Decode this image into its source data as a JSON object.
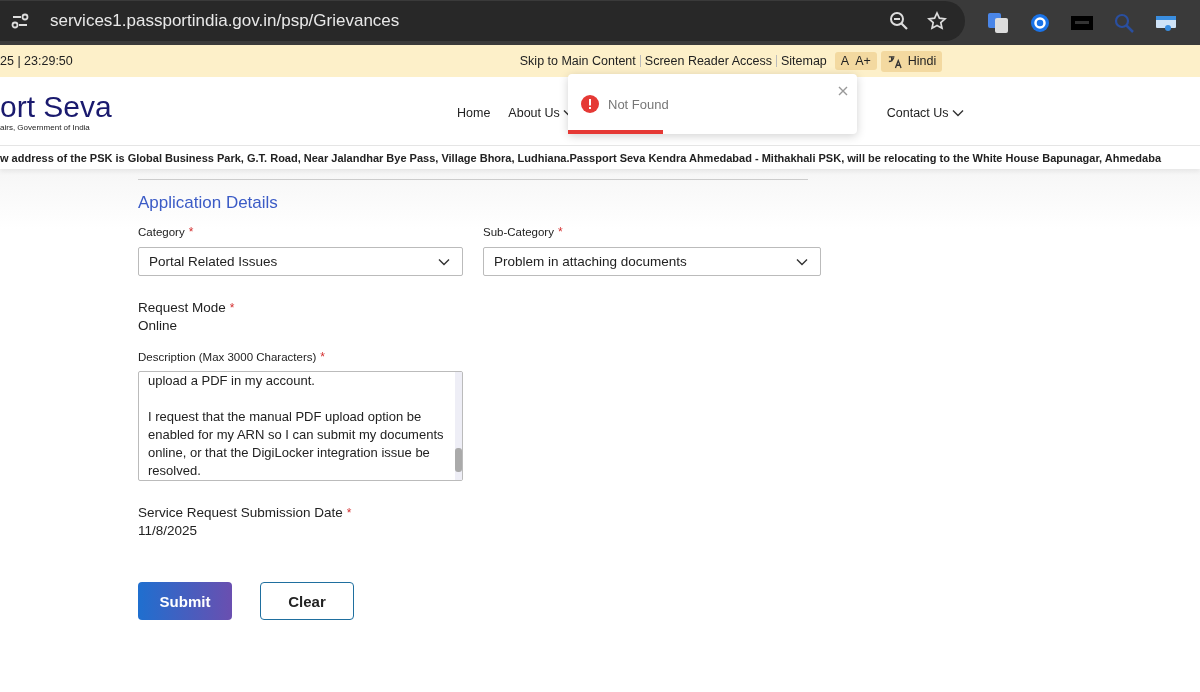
{
  "browser": {
    "url": "services1.passportindia.gov.in/psp/Grievances"
  },
  "top_bar": {
    "datetime": "25 | 23:29:50",
    "links": [
      "Skip to Main Content",
      "Screen Reader Access",
      "Sitemap"
    ],
    "font_sizes": [
      "A",
      "A+"
    ],
    "language": "Hindi"
  },
  "header": {
    "logo_title": "ort Seva",
    "logo_subtitle": "airs, Government of India",
    "nav": [
      {
        "label": "Home",
        "dropdown": false
      },
      {
        "label": "About Us",
        "dropdown": true
      },
      {
        "label": "Contact Us",
        "dropdown": true
      }
    ]
  },
  "ticker": "w address of the PSK is Global Business Park, G.T. Road, Near Jalandhar Bye Pass, Village Bhora, Ludhiana.Passport Seva Kendra Ahmedabad - Mithakhali PSK, will be relocating to the White House Bapunagar, Ahmedaba",
  "toast": {
    "message": "Not Found",
    "level": 0.33
  },
  "form": {
    "section_title": "Application Details",
    "category": {
      "label": "Category",
      "required_mark": "*",
      "value": "Portal Related Issues"
    },
    "sub_category": {
      "label": "Sub-Category",
      "required_mark": "*",
      "value": "Problem in attaching documents"
    },
    "request_mode": {
      "label": "Request Mode",
      "required_mark": "*",
      "value": "Online"
    },
    "description": {
      "label": "Description (Max 3000 Characters)",
      "required_mark": "*",
      "paragraphs": [
        "upload a PDF in my account.",
        "I request that the manual PDF upload option be enabled for my ARN so I can submit my documents online, or that the DigiLocker integration issue be resolved."
      ]
    },
    "submission_date": {
      "label": "Service Request Submission Date",
      "required_mark": "*",
      "value": "11/8/2025"
    },
    "buttons": [
      {
        "label": "Submit",
        "kind": "primary"
      },
      {
        "label": "Clear",
        "kind": "outline"
      }
    ]
  }
}
